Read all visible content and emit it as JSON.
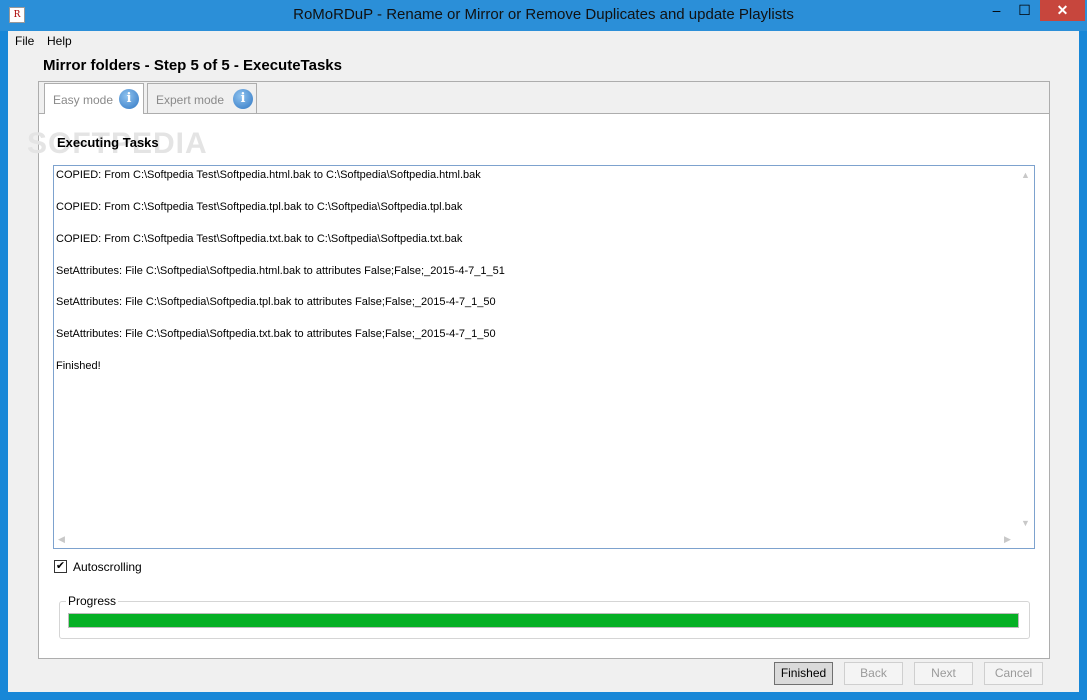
{
  "window": {
    "title": "RoMoRDuP - Rename or Mirror or Remove Duplicates and update Playlists",
    "icon_text": "R",
    "minimize": "–",
    "maximize": "☐",
    "close": "✕"
  },
  "menu": {
    "file": "File",
    "help": "Help"
  },
  "page": {
    "title": "Mirror folders - Step 5 of 5 - ExecuteTasks",
    "watermark": "SOFTPEDIA"
  },
  "tabs": [
    {
      "label": "Easy mode",
      "info": "i"
    },
    {
      "label": "Expert mode",
      "info": "i"
    }
  ],
  "section": {
    "title": "Executing Tasks"
  },
  "log": {
    "lines": [
      "COPIED: From C:\\Softpedia Test\\Softpedia.html.bak to C:\\Softpedia\\Softpedia.html.bak",
      "COPIED: From C:\\Softpedia Test\\Softpedia.tpl.bak to C:\\Softpedia\\Softpedia.tpl.bak",
      "COPIED: From C:\\Softpedia Test\\Softpedia.txt.bak to C:\\Softpedia\\Softpedia.txt.bak",
      "SetAttributes: File C:\\Softpedia\\Softpedia.html.bak to attributes False;False;_2015-4-7_1_51",
      "SetAttributes: File C:\\Softpedia\\Softpedia.tpl.bak to attributes False;False;_2015-4-7_1_50",
      "SetAttributes: File C:\\Softpedia\\Softpedia.txt.bak to attributes False;False;_2015-4-7_1_50",
      "Finished!"
    ]
  },
  "autoscroll": {
    "label": "Autoscrolling",
    "checked": true,
    "mark": "✔"
  },
  "progress": {
    "label": "Progress",
    "value": 1.0,
    "color": "#06b025"
  },
  "buttons": {
    "finished": "Finished",
    "back": "Back",
    "next": "Next",
    "cancel": "Cancel"
  },
  "icons": {
    "scroll_up": "▲",
    "scroll_down": "▼",
    "scroll_left": "◀",
    "scroll_right": "▶"
  }
}
